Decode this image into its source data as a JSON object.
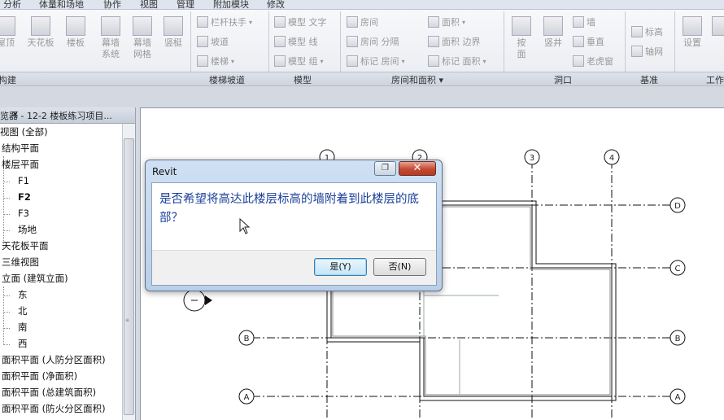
{
  "menubar": {
    "items": [
      "分析",
      "体量和场地",
      "协作",
      "视图",
      "管理",
      "附加模块",
      "修改"
    ]
  },
  "ribbon": {
    "build_buttons": [
      {
        "label": "屋顶",
        "icon": "roof-icon"
      },
      {
        "label": "天花板",
        "icon": "ceiling-icon"
      },
      {
        "label": "楼板",
        "icon": "floor-icon"
      },
      {
        "label": "幕墙\n系统",
        "icon": "curtain-system-icon"
      },
      {
        "label": "幕墙\n网格",
        "icon": "curtain-grid-icon"
      },
      {
        "label": "竖梃",
        "icon": "mullion-icon"
      }
    ],
    "circulation": {
      "railing": "栏杆扶手",
      "ramp": "坡道",
      "stair": "楼梯"
    },
    "model": {
      "text": "模型 文字",
      "line": "模型 线",
      "group": "模型 组"
    },
    "room": {
      "room": "房间",
      "separator": "房间 分隔",
      "tag": "标记 房间",
      "area": "面积",
      "boundary": "面积 边界",
      "area_tag": "标记 面积"
    },
    "opening": {
      "by_face": "按\n面",
      "shaft": "竖井",
      "wall": "墙",
      "vertical": "垂直",
      "dormer": "老虎窗"
    },
    "datum": {
      "level": "标高",
      "grid": "轴网"
    },
    "workplane": {
      "set": "设置"
    },
    "panels": {
      "build": "构建",
      "circulation": "楼梯坡道",
      "model": "模型",
      "room_area": "房间和面积",
      "opening": "洞口",
      "datum": "基准",
      "workplane": "工作"
    }
  },
  "browser": {
    "title": "览器 - 12-2 楼板练习项目...",
    "close": "✕",
    "items": [
      {
        "label": "视图 (全部)",
        "bold": false
      },
      {
        "label": "结构平面",
        "bold": false
      },
      {
        "label": "楼层平面",
        "bold": false
      },
      {
        "label": "F1",
        "bold": false
      },
      {
        "label": "F2",
        "bold": true
      },
      {
        "label": "F3",
        "bold": false
      },
      {
        "label": "场地",
        "bold": false
      },
      {
        "label": "天花板平面",
        "bold": false
      },
      {
        "label": "三维视图",
        "bold": false
      },
      {
        "label": "立面 (建筑立面)",
        "bold": false
      },
      {
        "label": "东",
        "bold": false
      },
      {
        "label": "北",
        "bold": false
      },
      {
        "label": "南",
        "bold": false
      },
      {
        "label": "西",
        "bold": false
      },
      {
        "label": "面积平面 (人防分区面积)",
        "bold": false
      },
      {
        "label": "面积平面 (净面积)",
        "bold": false
      },
      {
        "label": "面积平面 (总建筑面积)",
        "bold": false
      },
      {
        "label": "面积平面 (防火分区面积)",
        "bold": false
      }
    ]
  },
  "canvas": {
    "grid_top": [
      "1",
      "2",
      "3",
      "4"
    ],
    "grid_side": [
      "D",
      "C",
      "B",
      "A"
    ]
  },
  "dialog": {
    "title": "Revit",
    "message": "是否希望将高达此楼层标高的墙附着到此楼层的底部？",
    "yes_label": "是(Y)",
    "no_label": "否(N)",
    "close_glyph": "✕"
  },
  "colors": {
    "message_text": "#1b3f9a",
    "close_button": "#c34a33",
    "dialog_frame": "#b9cfe9"
  }
}
